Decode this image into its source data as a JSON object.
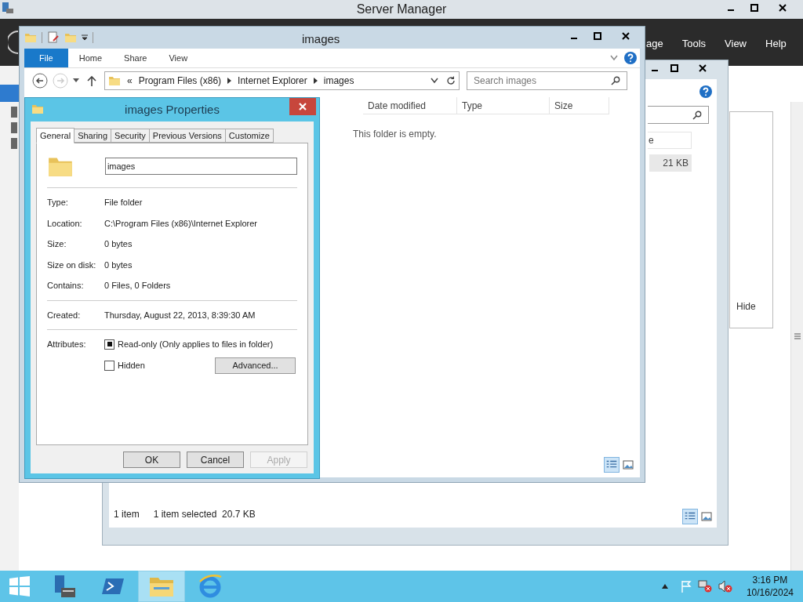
{
  "server_manager": {
    "title": "Server Manager",
    "menu": [
      "age",
      "Tools",
      "View",
      "Help"
    ],
    "sidebar": [
      {
        "selected": true
      },
      {
        "selected": false
      },
      {
        "selected": false
      },
      {
        "selected": false
      }
    ],
    "hide_button": "Hide"
  },
  "back_explorer": {
    "column_partial": "e",
    "size_cell": "21 KB",
    "status": {
      "count": "1 item",
      "selection": "1 item selected  20.7 KB"
    }
  },
  "explorer": {
    "title": "images",
    "ribbon_tabs": [
      {
        "label": "File",
        "selected": true
      },
      {
        "label": "Home",
        "selected": false
      },
      {
        "label": "Share",
        "selected": false
      },
      {
        "label": "View",
        "selected": false
      }
    ],
    "overflow": "«",
    "breadcrumb": [
      "Program Files (x86)",
      "Internet Explorer",
      "images"
    ],
    "search": {
      "placeholder": "Search images"
    },
    "columns": [
      "Date modified",
      "Type",
      "Size"
    ],
    "empty_message": "This folder is empty."
  },
  "properties": {
    "title": "images Properties",
    "tabs": [
      {
        "label": "General",
        "selected": true
      },
      {
        "label": "Sharing",
        "selected": false
      },
      {
        "label": "Security",
        "selected": false
      },
      {
        "label": "Previous Versions",
        "selected": false
      },
      {
        "label": "Customize",
        "selected": false
      }
    ],
    "name_value": "images",
    "sections": [
      {
        "rows": [
          {
            "label": "Type:",
            "value": "File folder"
          },
          {
            "label": "Location:",
            "value": "C:\\Program Files (x86)\\Internet Explorer"
          },
          {
            "label": "Size:",
            "value": "0 bytes"
          },
          {
            "label": "Size on disk:",
            "value": "0 bytes"
          },
          {
            "label": "Contains:",
            "value": "0 Files, 0 Folders"
          }
        ]
      },
      {
        "rows": [
          {
            "label": "Created:",
            "value": "Thursday, August 22, 2013, 8:39:30 AM"
          }
        ]
      }
    ],
    "attributes": {
      "label": "Attributes:",
      "items": [
        {
          "label": "Read-only (Only applies to files in folder)",
          "checked": true
        },
        {
          "label": "Hidden",
          "checked": false
        }
      ],
      "advanced": "Advanced..."
    },
    "buttons": [
      {
        "label": "OK",
        "disabled": false
      },
      {
        "label": "Cancel",
        "disabled": false
      },
      {
        "label": "Apply",
        "disabled": true
      }
    ]
  },
  "taskbar": {
    "apps": [
      {
        "selected": false
      },
      {
        "selected": false
      },
      {
        "selected": true
      },
      {
        "selected": false
      }
    ],
    "time": "3:16 PM",
    "date": "10/16/2024"
  }
}
